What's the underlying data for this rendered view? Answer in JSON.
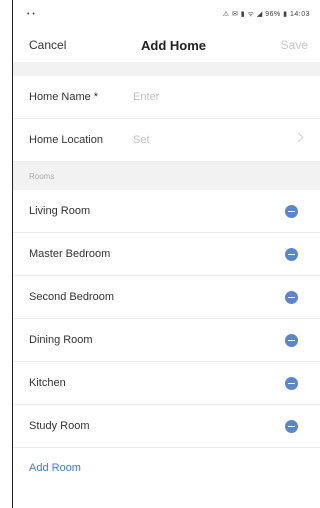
{
  "status_bar": {
    "left": "• •",
    "right": "⚠ ✉ ▮ ᯤ ◢ 96% ▮ 14:03"
  },
  "nav": {
    "cancel_label": "Cancel",
    "title": "Add Home",
    "save_label": "Save"
  },
  "form": {
    "home_name_label": "Home Name *",
    "home_name_placeholder": "Enter",
    "home_location_label": "Home Location",
    "home_location_value": "Set"
  },
  "rooms_header": "Rooms",
  "rooms": [
    "Living Room",
    "Master Bedroom",
    "Second Bedroom",
    "Dining Room",
    "Kitchen",
    "Study Room"
  ],
  "add_room_label": "Add Room",
  "colors": {
    "accent": "#3f7bd6",
    "remove_icon": "#5b86c7",
    "section_background": "#f2f2f2"
  }
}
